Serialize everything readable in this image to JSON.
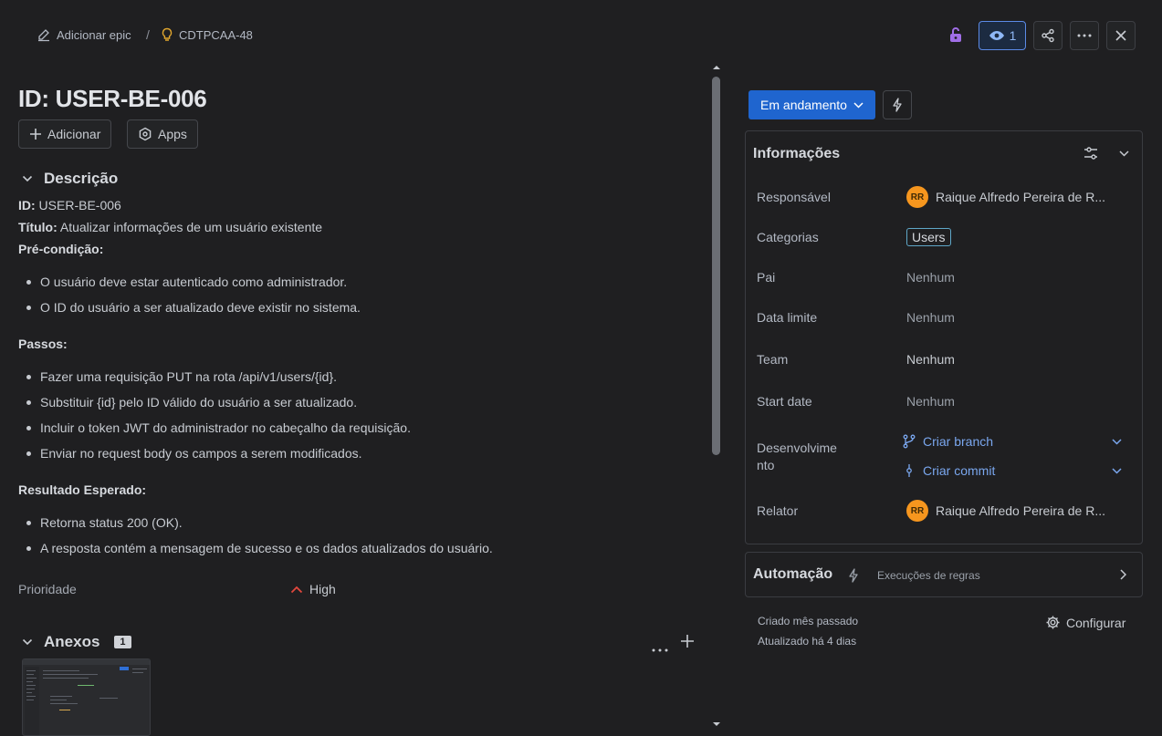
{
  "breadcrumb": {
    "add_epic": "Adicionar epic",
    "separator": "/",
    "issue_key": "CDTPCAA-48"
  },
  "toolbar": {
    "watch_count": "1"
  },
  "issue": {
    "title": "ID: USER-BE-006",
    "add_label": "Adicionar",
    "apps_label": "Apps"
  },
  "description": {
    "heading": "Descrição",
    "id_label": "ID:",
    "id_value": " USER-BE-006",
    "title_label": "Título:",
    "title_value": " Atualizar informações de um usuário existente",
    "precondition_label": "Pré-condição:",
    "preconditions": [
      "O usuário deve estar autenticado como administrador.",
      "O ID do usuário a ser atualizado deve existir no sistema."
    ],
    "steps_label": "Passos:",
    "steps": [
      "Fazer uma requisição PUT na rota /api/v1/users/{id}.",
      "Substituir {id} pelo ID válido do usuário a ser atualizado.",
      "Incluir o token JWT do administrador no cabeçalho da requisição.",
      "Enviar no request body os campos a serem modificados."
    ],
    "expected_label": "Resultado Esperado:",
    "expected": [
      "Retorna status 200 (OK).",
      "A resposta contém a mensagem de sucesso e os dados atualizados do usuário."
    ]
  },
  "priority": {
    "label": "Prioridade",
    "value": "High"
  },
  "attachments": {
    "heading": "Anexos",
    "count": "1"
  },
  "status": {
    "label": "Em andamento"
  },
  "info": {
    "title": "Informações",
    "assignee_label": "Responsável",
    "assignee_initials": "RR",
    "assignee_name": "Raique Alfredo Pereira de R...",
    "categories_label": "Categorias",
    "category_tag": "Users",
    "parent_label": "Pai",
    "parent_value": "Nenhum",
    "due_label": "Data limite",
    "due_value": "Nenhum",
    "team_label": "Team",
    "team_value": "Nenhum",
    "start_label": "Start date",
    "start_value": "Nenhum",
    "dev_label_1": "Desenvolvime",
    "dev_label_2": "nto",
    "create_branch": "Criar branch",
    "create_commit": "Criar commit",
    "reporter_label": "Relator",
    "reporter_initials": "RR",
    "reporter_name": "Raique Alfredo Pereira de R..."
  },
  "automation": {
    "title": "Automação",
    "rules_link": "Execuções de regras"
  },
  "footer": {
    "created": "Criado mês passado",
    "updated": "Atualizado há 4 dias",
    "configure": "Configurar"
  },
  "colors": {
    "accent": "#1f65cf",
    "avatar": "#f6961e",
    "priority_high": "#e2483d",
    "link": "#7aa7ef"
  }
}
